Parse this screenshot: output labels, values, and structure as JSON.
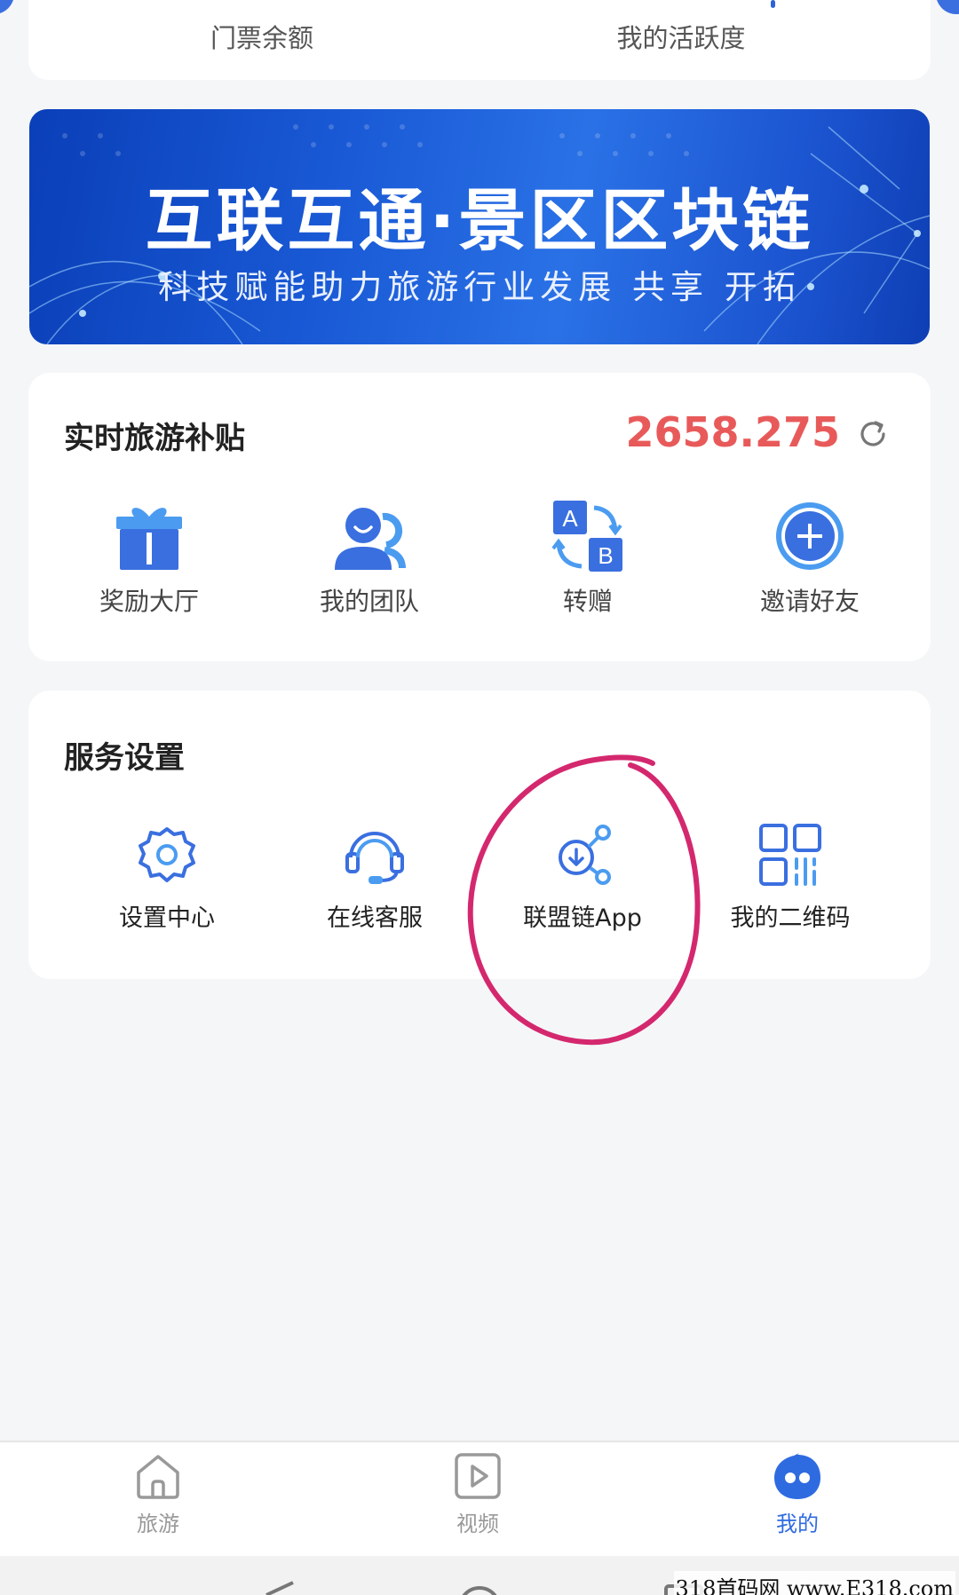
{
  "top_card": {
    "label_left": "门票余额",
    "label_right": "我的活跃度"
  },
  "banner": {
    "title": "互联互通·景区区块链",
    "subtitle": "科技赋能助力旅游行业发展 共享 开拓"
  },
  "subsidy": {
    "title": "实时旅游补贴",
    "amount": "2658.275",
    "items": [
      {
        "label": "奖励大厅",
        "icon": "gift-icon"
      },
      {
        "label": "我的团队",
        "icon": "team-icon"
      },
      {
        "label": "转赠",
        "icon": "transfer-ab-icon"
      },
      {
        "label": "邀请好友",
        "icon": "plus-circle-icon"
      }
    ]
  },
  "services": {
    "title": "服务设置",
    "items": [
      {
        "label": "设置中心",
        "icon": "gear-icon"
      },
      {
        "label": "在线客服",
        "icon": "headset-icon"
      },
      {
        "label": "联盟链App",
        "icon": "share-download-icon"
      },
      {
        "label": "我的二维码",
        "icon": "qr-code-icon"
      }
    ]
  },
  "tabbar": {
    "tabs": [
      {
        "label": "旅游",
        "icon": "home-icon",
        "active": false
      },
      {
        "label": "视频",
        "icon": "play-icon",
        "active": false
      },
      {
        "label": "我的",
        "icon": "profile-face-icon",
        "active": true
      }
    ]
  },
  "colors": {
    "accent": "#2f6be0",
    "amount": "#e85a5a",
    "annotation": "#d4286e"
  },
  "watermark": "318首码网 www.E318.com"
}
